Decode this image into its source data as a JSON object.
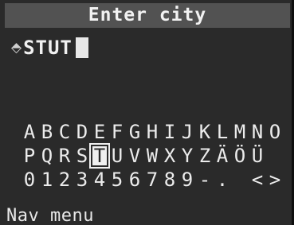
{
  "title": "Enter city",
  "entry": {
    "arrow_icon": "up-down-arrow-icon",
    "value": "STUT"
  },
  "keyboard": {
    "rows": [
      [
        "A",
        "B",
        "C",
        "D",
        "E",
        "F",
        "G",
        "H",
        "I",
        "J",
        "K",
        "L",
        "M",
        "N",
        "O"
      ],
      [
        "P",
        "Q",
        "R",
        "S",
        "T",
        "U",
        "V",
        "W",
        "X",
        "Y",
        "Z",
        "Ä",
        "Ö",
        "Ü"
      ],
      [
        "0",
        "1",
        "2",
        "3",
        "4",
        "5",
        "6",
        "7",
        "8",
        "9",
        "-",
        ".",
        " ",
        "<",
        ">"
      ]
    ],
    "selected": "T"
  },
  "footer": {
    "label": "Nav menu"
  }
}
